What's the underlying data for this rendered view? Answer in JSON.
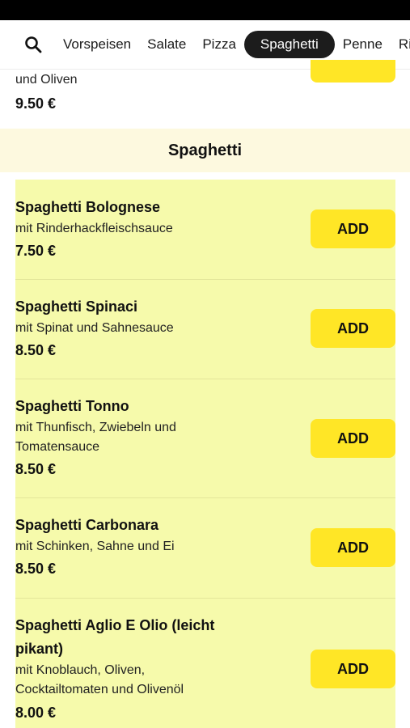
{
  "nav": {
    "search_icon": "search-icon",
    "categories": [
      {
        "label": "Vorspeisen",
        "active": false
      },
      {
        "label": "Salate",
        "active": false
      },
      {
        "label": "Pizza",
        "active": false
      },
      {
        "label": "Spaghetti",
        "active": true
      },
      {
        "label": "Penne",
        "active": false
      },
      {
        "label": "Ri",
        "active": false
      }
    ]
  },
  "previous_item": {
    "description": "und Oliven",
    "price": "9.50 €"
  },
  "section": {
    "title": "Spaghetti",
    "items": [
      {
        "name": "Spaghetti Bolognese",
        "description": "mit Rinderhackfleischsauce",
        "price": "7.50 €",
        "button": "ADD"
      },
      {
        "name": "Spaghetti Spinaci",
        "description": "mit Spinat und Sahnesauce",
        "price": "8.50 €",
        "button": "ADD"
      },
      {
        "name": "Spaghetti Tonno",
        "description": "mit Thunfisch, Zwiebeln und Tomatensauce",
        "price": "8.50 €",
        "button": "ADD"
      },
      {
        "name": "Spaghetti Carbonara",
        "description": "mit Schinken, Sahne und Ei",
        "price": "8.50 €",
        "button": "ADD"
      },
      {
        "name": "Spaghetti Aglio E Olio (leicht pikant)",
        "description": "mit Knoblauch, Oliven, Cocktailtomaten und Olivenöl",
        "price": "8.00 €",
        "button": "ADD"
      }
    ]
  },
  "colors": {
    "accent": "#ffe626",
    "item_background": "#f6faab",
    "section_header_background": "#fdf9df",
    "active_tab": "#1c1c1c"
  }
}
